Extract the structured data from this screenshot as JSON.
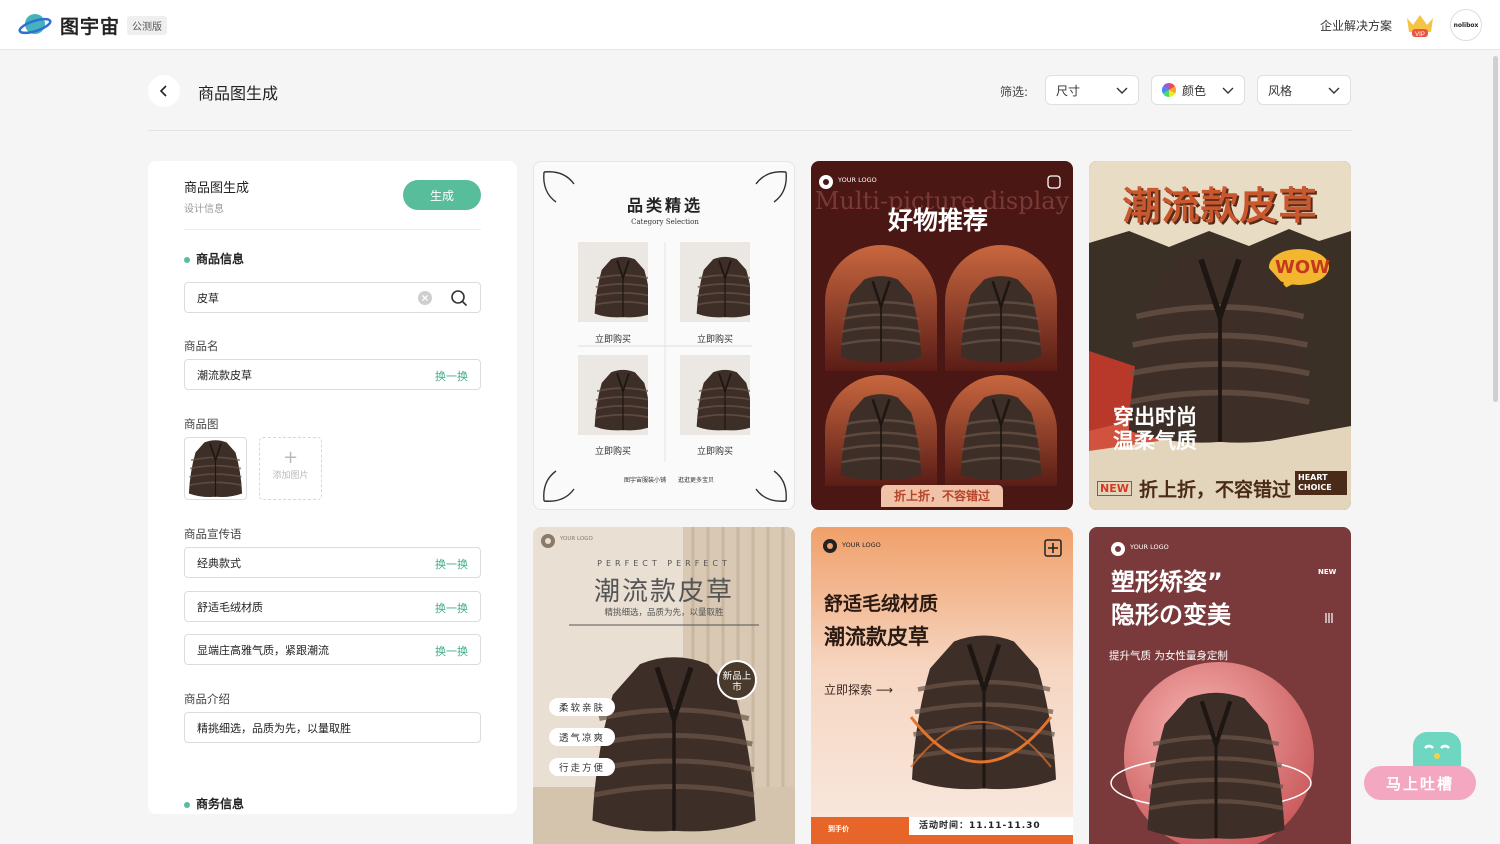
{
  "header": {
    "brand": "图宇宙",
    "beta_badge": "公测版",
    "enterprise_link": "企业解决方案",
    "vip_label": "VIP",
    "avatar_text": "nolibox"
  },
  "page": {
    "title": "商品图生成",
    "filter_label": "筛选:",
    "filters": [
      {
        "label": "尺寸"
      },
      {
        "label": "颜色"
      },
      {
        "label": "风格"
      }
    ]
  },
  "panel": {
    "title": "商品图生成",
    "subtitle": "设计信息",
    "generate_label": "生成",
    "section_product": "商品信息",
    "search_value": "皮草",
    "name_label": "商品名",
    "name_value": "潮流款皮草",
    "swap_label": "换一换",
    "image_label": "商品图",
    "add_image_label": "添加图片",
    "slogan_label": "商品宣传语",
    "slogans": [
      "经典款式",
      "舒适毛绒材质",
      "显端庄高雅气质，紧跟潮流"
    ],
    "intro_label": "商品介绍",
    "intro_value": "精挑细选，品质为先，以量取胜",
    "section_business": "商务信息"
  },
  "cards": {
    "c1": {
      "title": "品类精选",
      "subtitle": "Category Selection",
      "buy": "立即购买",
      "footer_left": "图宇宙服装小铺",
      "footer_right": "逛逛更多宝贝"
    },
    "c2": {
      "logo": "YOUR LOGO",
      "bg_text": "Multi-picture display",
      "title": "好物推荐",
      "banner": "折上折，不容错过"
    },
    "c3": {
      "title": "潮流款皮草",
      "wow": "WOW",
      "slogan1": "穿出时尚",
      "slogan2": "温柔气质",
      "new": "NEW",
      "bottom": "折上折，不容错过",
      "heart": "HEART CHOICE"
    },
    "c4": {
      "logo": "YOUR LOGO",
      "perfect": "PERFECT PERFECT",
      "title": "潮流款皮草",
      "sub": "精挑细选，品质为先，以量取胜",
      "badge": "新品上市",
      "tags": [
        "柔软亲肤",
        "透气凉爽",
        "行走方便"
      ]
    },
    "c5": {
      "logo": "YOUR LOGO",
      "title1": "舒适毛绒材质",
      "title2": "潮流款皮草",
      "explore": "立即探索",
      "price_label": "到手价",
      "activity": "活动时间：11.11-11.30"
    },
    "c6": {
      "logo": "YOUR LOGO",
      "title1": "塑形矫姿”",
      "title2": "隐形の变美",
      "new": "NEW",
      "sub": "提升气质 为女性量身定制"
    }
  },
  "feedback": {
    "label": "马上吐槽"
  },
  "colors": {
    "accent": "#57bd9b",
    "swap": "#3fae8a",
    "card2_bg": "#4a1714",
    "card6_bg": "#7a3a3c"
  }
}
